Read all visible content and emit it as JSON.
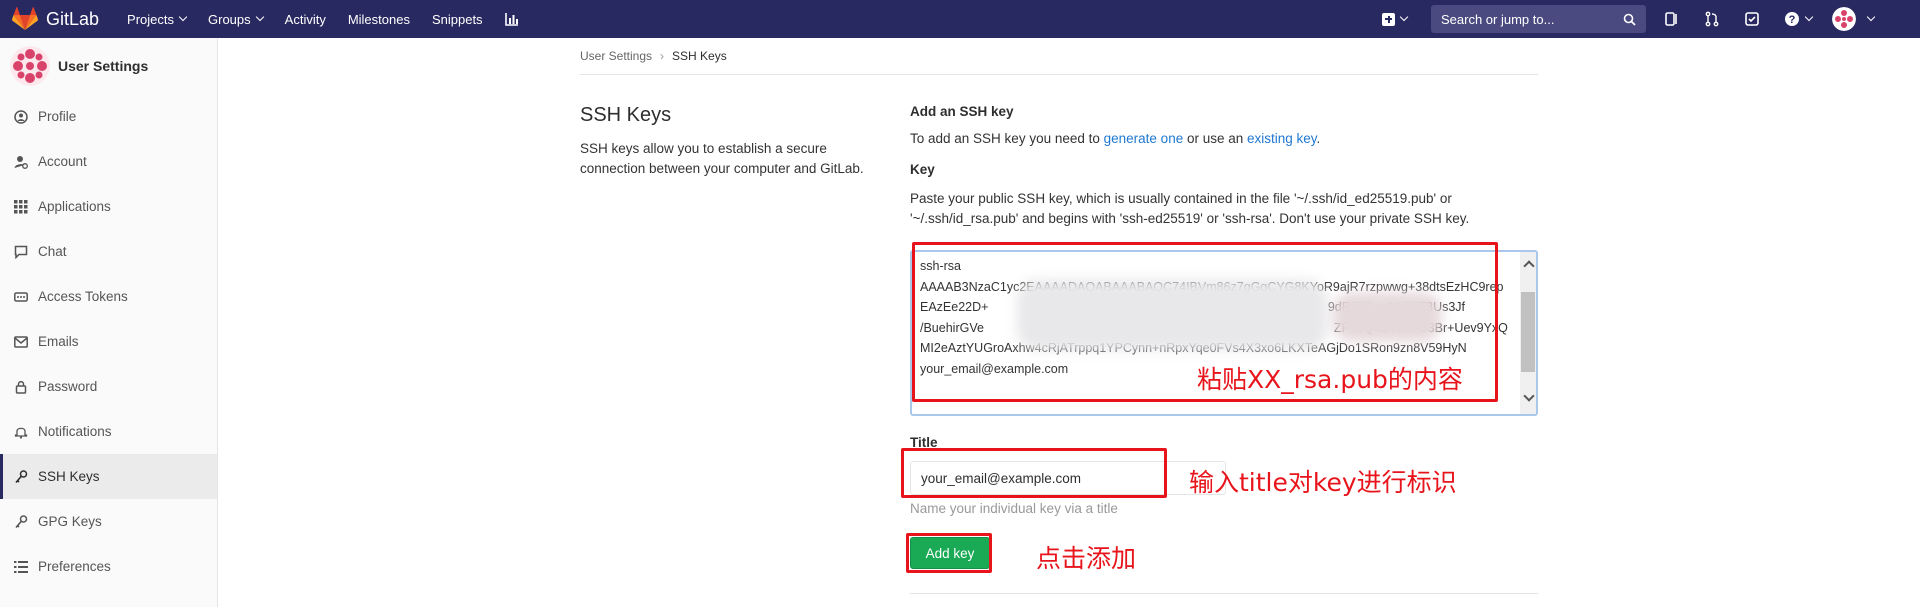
{
  "brand": {
    "name": "GitLab"
  },
  "nav": {
    "links": [
      "Projects",
      "Groups",
      "Activity",
      "Milestones",
      "Snippets"
    ],
    "search_placeholder": "Search or jump to..."
  },
  "sidebar": {
    "title": "User Settings",
    "items": [
      {
        "label": "Profile",
        "icon": "profile-icon"
      },
      {
        "label": "Account",
        "icon": "account-icon"
      },
      {
        "label": "Applications",
        "icon": "applications-icon"
      },
      {
        "label": "Chat",
        "icon": "chat-icon"
      },
      {
        "label": "Access Tokens",
        "icon": "token-icon"
      },
      {
        "label": "Emails",
        "icon": "email-icon"
      },
      {
        "label": "Password",
        "icon": "lock-icon"
      },
      {
        "label": "Notifications",
        "icon": "bell-icon"
      },
      {
        "label": "SSH Keys",
        "icon": "key-icon",
        "active": true
      },
      {
        "label": "GPG Keys",
        "icon": "key-icon"
      },
      {
        "label": "Preferences",
        "icon": "preferences-icon"
      }
    ]
  },
  "breadcrumb": {
    "parent": "User Settings",
    "current": "SSH Keys"
  },
  "left": {
    "heading": "SSH Keys",
    "description": "SSH keys allow you to establish a secure connection between your computer and GitLab."
  },
  "form": {
    "heading": "Add an SSH key",
    "intro_before": "To add an SSH key you need to ",
    "intro_link1": "generate one",
    "intro_mid": " or use an ",
    "intro_link2": "existing key",
    "intro_after": ".",
    "key_label": "Key",
    "key_help": "Paste your public SSH key, which is usually contained in the file '~/.ssh/id_ed25519.pub' or '~/.ssh/id_rsa.pub' and begins with 'ssh-ed25519' or 'ssh-rsa'. Don't use your private SSH key.",
    "key_value": "ssh-rsa\nAAAAB3NzaC1yc2EAAAADAQABAAABAQC74IBVm86z7gGqCYG8KYoR9ajR7rzpwwg+38dtsEzHC9repEAzEe22D+                    A0q0oNxWK0YDC2SaLI74yN8Ju+                      9dPJEG+pNIiFIfT3Us3Jf                              /BuehirGVe                    TiOGGe+micToI6wXIQrFPuuMYiw5hct/HDv           ZPTvQ4BVh6FU3Br+Uev9YxQMI2eAztYUGroAxhw4cRjATrppq1YPCynn+nRpxYqe0FVs4X3xo6LKXTeAGjDo1SRon9zn8V59HyN\nyour_email@example.com",
    "title_label": "Title",
    "title_value": "your_email@example.com",
    "title_help": "Name your individual key via a title",
    "submit_label": "Add key"
  },
  "annotations": {
    "key": "粘贴XX_rsa.pub的内容",
    "title": "输入title对key进行标识",
    "button": "点击添加",
    "color": "#e8141b"
  },
  "colors": {
    "nav_bg": "#292961",
    "primary_button": "#1aaa55",
    "link": "#1f78d1"
  }
}
